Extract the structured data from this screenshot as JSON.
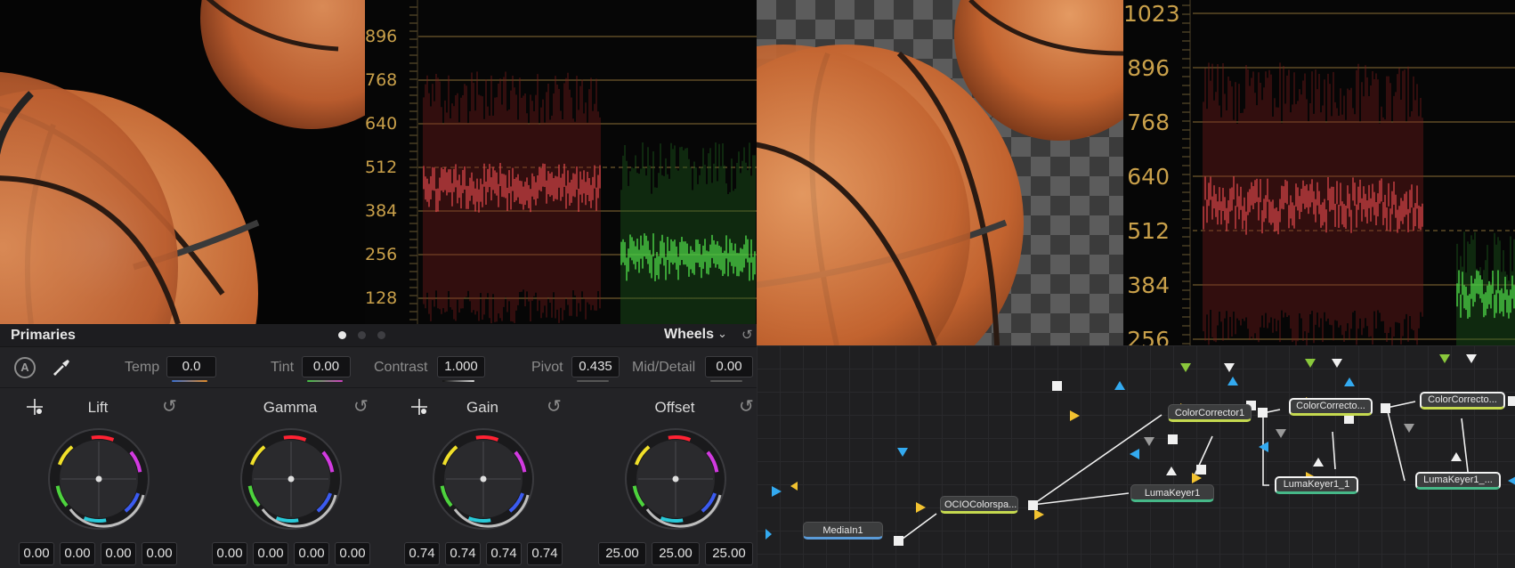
{
  "scope_left": {
    "labels": [
      "896",
      "768",
      "640",
      "512",
      "384",
      "256",
      "128"
    ]
  },
  "scope_right": {
    "labels": [
      "1023",
      "896",
      "768",
      "640",
      "512",
      "384",
      "256"
    ]
  },
  "primaries": {
    "title": "Primaries",
    "mode": "Wheels",
    "page_dots": 3,
    "active_dot": 0,
    "auto_label": "A",
    "params": {
      "temp": {
        "label": "Temp",
        "value": "0.0"
      },
      "tint": {
        "label": "Tint",
        "value": "0.00"
      },
      "contrast": {
        "label": "Contrast",
        "value": "1.000"
      },
      "pivot": {
        "label": "Pivot",
        "value": "0.435"
      },
      "mid_detail": {
        "label": "Mid/Detail",
        "value": "0.00"
      }
    },
    "wheels": [
      {
        "name": "Lift",
        "values": [
          "0.00",
          "0.00",
          "0.00",
          "0.00"
        ]
      },
      {
        "name": "Gamma",
        "values": [
          "0.00",
          "0.00",
          "0.00",
          "0.00"
        ]
      },
      {
        "name": "Gain",
        "values": [
          "0.74",
          "0.74",
          "0.74",
          "0.74"
        ]
      },
      {
        "name": "Offset",
        "values": [
          "25.00",
          "25.00",
          "25.00"
        ]
      }
    ]
  },
  "nodes": {
    "media_in": "MediaIn1",
    "ocio": "OCIOColorspa...",
    "cc1": "ColorCorrector1",
    "cc2": "ColorCorrecto...",
    "cc3": "ColorCorrecto...",
    "lk1": "LumaKeyer1",
    "lk2": "LumaKeyer1_1",
    "lk3": "LumaKeyer1_..."
  },
  "colors": {
    "scope_label": "#c9a04a",
    "accent_green": "#c5d94f",
    "luma_keyer": "#46b888",
    "media_in": "#5a9bd8",
    "input_arrow": "#f2c230",
    "mask_arrow": "#33aaf0"
  },
  "icons": [
    "auto-balance-icon",
    "color-picker-icon",
    "crosshair-icon",
    "reset-icon",
    "chevron-down-icon",
    "overflow-icon"
  ]
}
